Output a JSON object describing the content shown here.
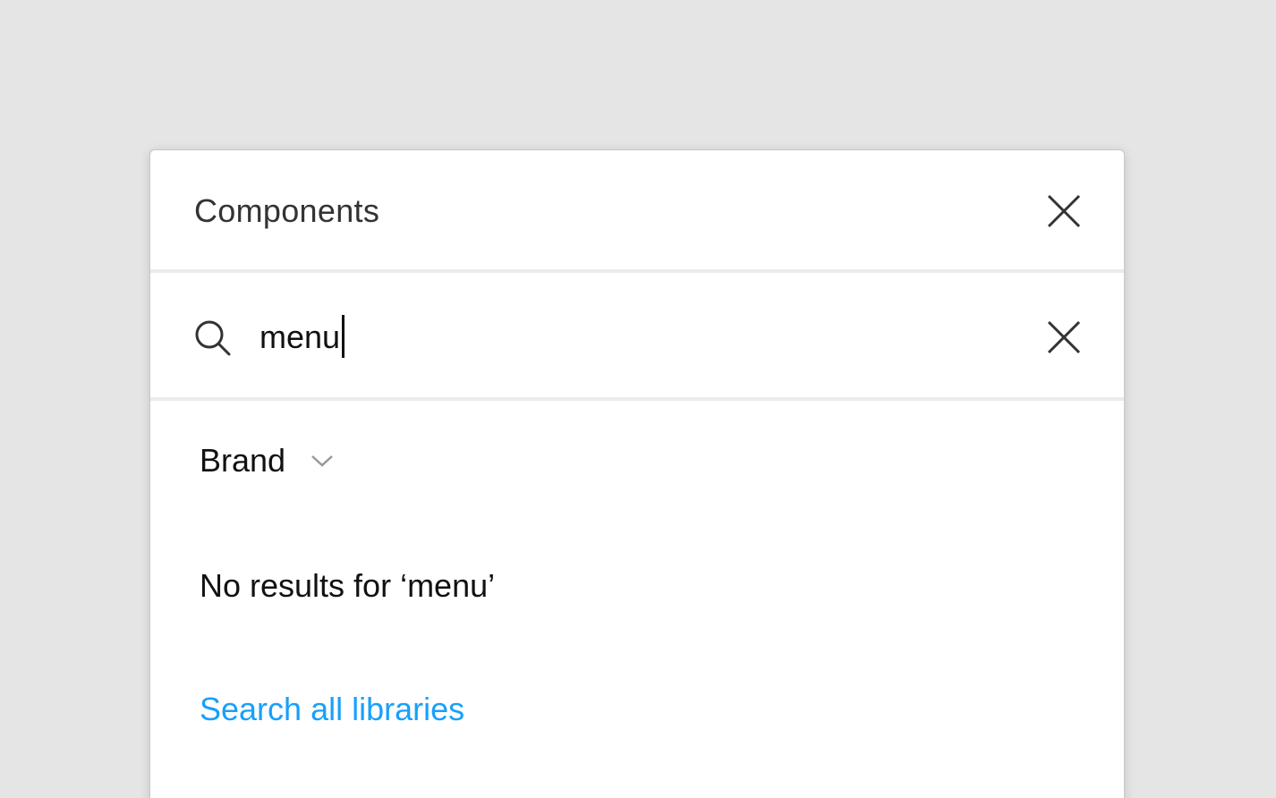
{
  "panel": {
    "title": "Components"
  },
  "search": {
    "value": "menu",
    "placeholder": ""
  },
  "library": {
    "name": "Brand"
  },
  "results": {
    "empty_message": "No results for ‘menu’",
    "search_all_label": "Search all libraries"
  },
  "icons": {
    "close": "close-icon",
    "search": "search-icon",
    "clear": "clear-icon",
    "chevron": "chevron-down-icon"
  },
  "colors": {
    "background": "#e5e5e5",
    "panel": "#ffffff",
    "link": "#18a0fb",
    "text": "#111111",
    "divider": "#ececec"
  }
}
